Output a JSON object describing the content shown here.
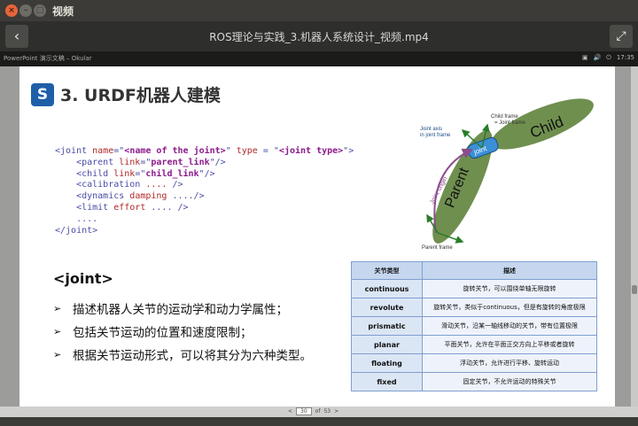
{
  "window": {
    "title": "视频",
    "close_glyph": "×",
    "min_glyph": "–",
    "max_glyph": "□"
  },
  "player": {
    "back_glyph": "‹",
    "title": "ROS理论与实践_3.机器人系统设计_视频.mp4",
    "fullscreen_glyph": "⤢"
  },
  "okular": {
    "title": "PowerPoint 演示文稿 – Okular",
    "tray": [
      "▣",
      "🔊",
      "⏻",
      "17:35"
    ]
  },
  "slide": {
    "logo": "S",
    "title": "3. URDF机器人建模",
    "code": {
      "line1": {
        "open": "<joint ",
        "a1": "name",
        "eq1": "=\"",
        "s1": "<name of the joint>",
        "q1": "\" ",
        "a2": "type",
        "eq2": " = \"",
        "s2": "<joint type>",
        "close": "\">"
      },
      "line2": {
        "open": "    <parent ",
        "a": "link",
        "eq": "=\"",
        "s": "parent_link",
        "close": "\"/>"
      },
      "line3": {
        "open": "    <child ",
        "a": "link",
        "eq": "=\"",
        "s": "child_link",
        "close": "\"/>"
      },
      "line4": {
        "open": "    <calibration ",
        "a": "....",
        "close": " />"
      },
      "line5": {
        "open": "    <dynamics ",
        "a": "damping",
        "close": " ..../>"
      },
      "line6": {
        "open": "    <limit ",
        "a": "effort",
        "close": " .... />"
      },
      "line7": "    ....",
      "line8": "</joint>"
    },
    "joint_heading": "<joint>",
    "bullets": [
      "描述机器人关节的运动学和动力学属性；",
      "包括关节运动的位置和速度限制；",
      "根据关节运动形式，可以将其分为六种类型。"
    ],
    "diagram": {
      "child": "Child",
      "parent": "Parent",
      "joint": "joint",
      "child_frame": "Child frame\n= Joint frame",
      "joint_axis": "Joint axis\nin joint frame",
      "joint_origin": "Joint origin",
      "parent_frame": "Parent frame"
    },
    "table": {
      "headers": [
        "关节类型",
        "描述"
      ],
      "rows": [
        {
          "type": "continuous",
          "desc": "旋转关节，可以围绕单轴无限旋转"
        },
        {
          "type": "revolute",
          "desc": "旋转关节，类似于continuous，但是有旋转的角度极限"
        },
        {
          "type": "prismatic",
          "desc": "滑动关节，沿某一轴线移动的关节，带有位置极限"
        },
        {
          "type": "planar",
          "desc": "平面关节，允许在平面正交方向上平移或者旋转"
        },
        {
          "type": "floating",
          "desc": "浮动关节，允许进行平移、旋转运动"
        },
        {
          "type": "fixed",
          "desc": "固定关节，不允许运动的特殊关节"
        }
      ]
    }
  },
  "pager": {
    "prev": "<",
    "page": "30",
    "of": "of",
    "total": "53",
    "next": ">"
  },
  "colors": {
    "accent": "#1f5fa8",
    "link_green": "#5c7a3e",
    "joint_blue": "#3a8fd6"
  }
}
